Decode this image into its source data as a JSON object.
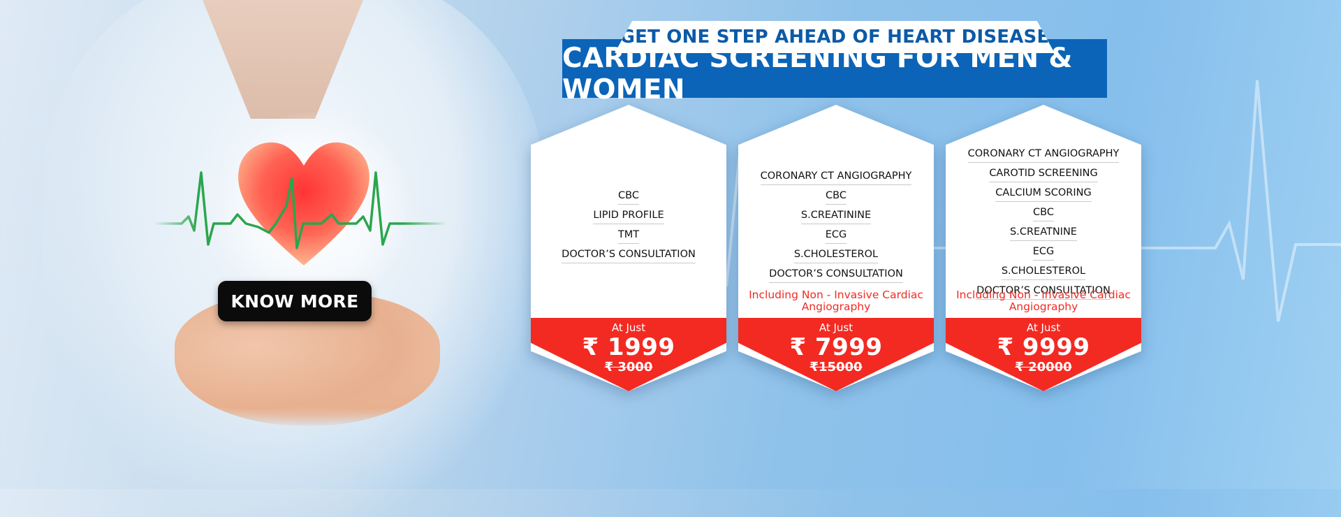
{
  "banner": {
    "tagline": "GET ONE STEP AHEAD OF HEART DISEASE",
    "title": "CARDIAC SCREENING FOR MEN & WOMEN",
    "cta_label": "KNOW MORE"
  },
  "colors": {
    "brand_blue": "#0b64b7",
    "accent_red": "#f32a22",
    "cta_black": "#0b0b0b"
  },
  "packages": [
    {
      "items": [
        "CBC",
        "LIPID PROFILE",
        "TMT",
        "DOCTOR’S CONSULTATION"
      ],
      "note": "",
      "at_just": "At Just",
      "price": "₹ 1999",
      "old_price": "₹ 3000"
    },
    {
      "items": [
        "CORONARY CT ANGIOGRAPHY",
        "CBC",
        "S.CREATININE",
        "ECG",
        "S.CHOLESTEROL",
        "DOCTOR’S CONSULTATION"
      ],
      "note": "Including Non - Invasive Cardiac Angiography",
      "at_just": "At Just",
      "price": "₹ 7999",
      "old_price": "₹15000"
    },
    {
      "items": [
        "CORONARY CT ANGIOGRAPHY",
        "CAROTID SCREENING",
        "CALCIUM SCORING",
        "CBC",
        "S.CREATNINE",
        "ECG",
        "S.CHOLESTEROL",
        "DOCTOR’S CONSULTATION"
      ],
      "note": "Including Non - Invasive Cardiac Angiography",
      "at_just": "At Just",
      "price": "₹ 9999",
      "old_price": "₹ 20000"
    }
  ],
  "icons": {
    "heart": "heart-icon",
    "ecg": "ecg-line-icon"
  }
}
